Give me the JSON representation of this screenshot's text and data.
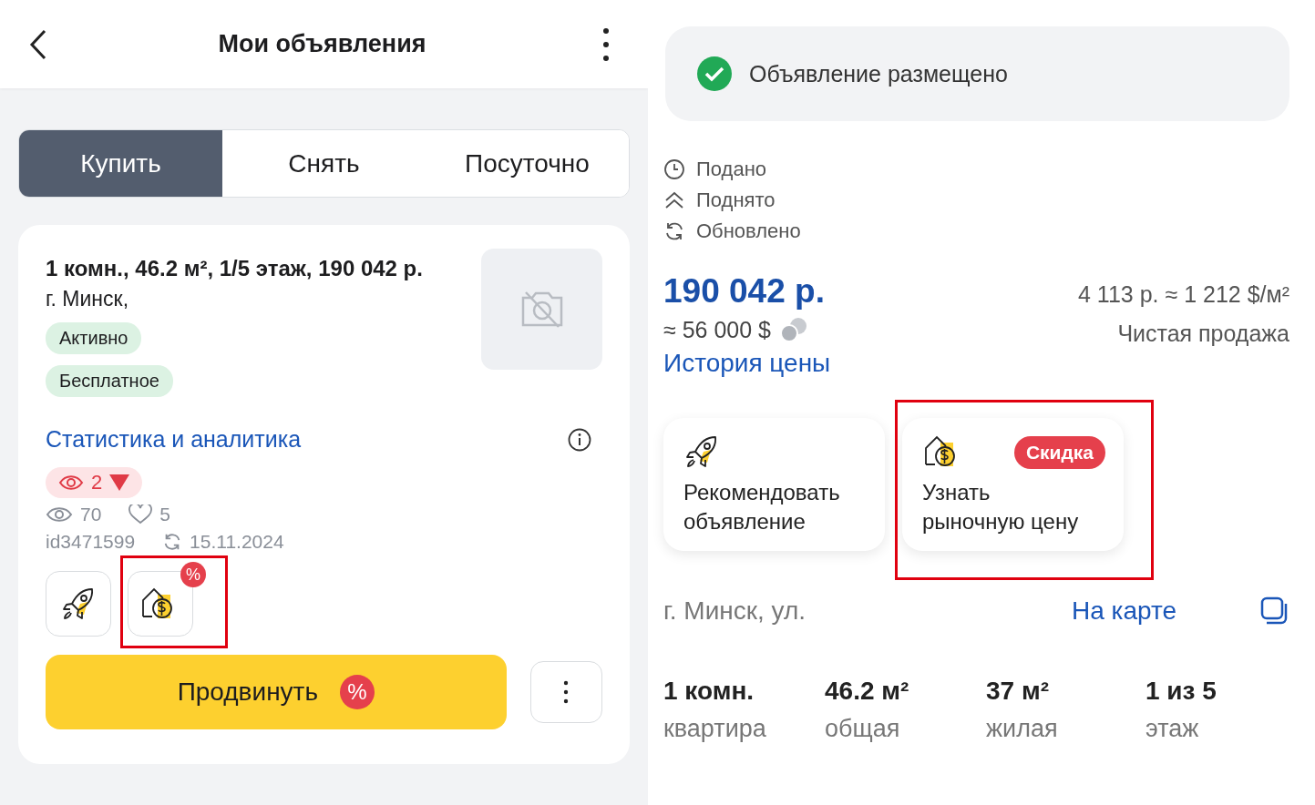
{
  "left": {
    "header": {
      "title": "Мои объявления"
    },
    "tabs": [
      {
        "label": "Купить",
        "selected": true
      },
      {
        "label": "Снять",
        "selected": false
      },
      {
        "label": "Посуточно",
        "selected": false
      }
    ],
    "listing": {
      "title": "1 комн., 46.2 м², 1/5 этаж, 190 042 р.",
      "address": "г. Минск,",
      "badges": [
        "Активно",
        "Бесплатное"
      ],
      "stats_link": "Статистика и аналитика",
      "views_change": {
        "value": "2",
        "decreased": true
      },
      "views": "70",
      "likes": "5",
      "id": "id3471599",
      "updated": "15.11.2024",
      "actions": [
        {
          "kind": "promote",
          "highlighted": false
        },
        {
          "kind": "market_price",
          "badge": "%",
          "highlighted": true
        }
      ],
      "promote_button": {
        "label": "Продвинуть",
        "badge": "%"
      }
    }
  },
  "right": {
    "status": "Объявление размещено",
    "dates": [
      {
        "kind": "posted",
        "label": "Подано"
      },
      {
        "kind": "raised",
        "label": "Поднято"
      },
      {
        "kind": "updated",
        "label": "Обновлено"
      }
    ],
    "price": "190 042 р.",
    "price_usd": "≈ 56 000 $",
    "price_history_link": "История цены",
    "price_per_m2": "4 113 р. ≈ 1 212 $/м²",
    "deal_type": "Чистая продажа",
    "services": [
      {
        "kind": "promote",
        "title": "Рекомендовать объявление",
        "highlighted": false
      },
      {
        "kind": "market_price",
        "title": "Узнать рыночную цену",
        "badge": "Скидка",
        "highlighted": true
      }
    ],
    "address": "г. Минск, ул.",
    "map_link": "На карте",
    "specs": [
      {
        "value": "1 комн.",
        "label": "квартира"
      },
      {
        "value": "46.2 м²",
        "label": "общая"
      },
      {
        "value": "37 м²",
        "label": "жилая"
      },
      {
        "value": "1 из 5",
        "label": "этаж"
      }
    ]
  }
}
